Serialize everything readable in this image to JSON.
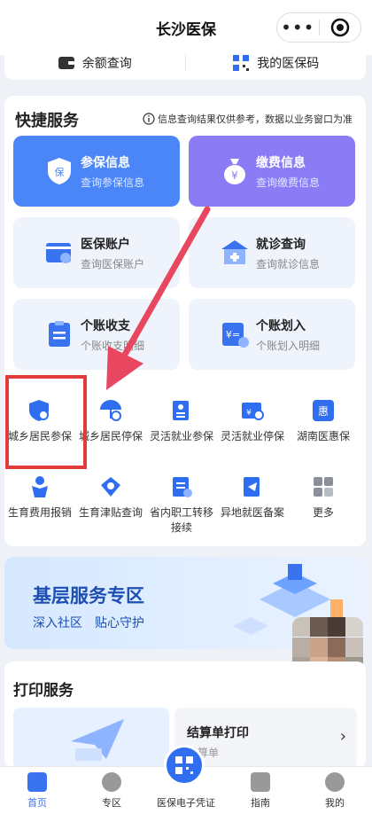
{
  "header": {
    "title": "长沙医保"
  },
  "top_links": [
    {
      "label": "余额查询",
      "icon": "wallet-icon"
    },
    {
      "label": "我的医保码",
      "icon": "qrcode-icon"
    }
  ],
  "quick": {
    "title": "快捷服务",
    "notice": "信息查询结果仅供参考，数据以业务窗口为准",
    "tiles": [
      {
        "name": "参保信息",
        "sub": "查询参保信息",
        "icon": "shield-insurance-icon"
      },
      {
        "name": "缴费信息",
        "sub": "查询缴费信息",
        "icon": "money-bag-icon"
      },
      {
        "name": "医保账户",
        "sub": "查询医保账户",
        "icon": "account-card-icon"
      },
      {
        "name": "就诊查询",
        "sub": "查询就诊信息",
        "icon": "hospital-icon"
      },
      {
        "name": "个账收支",
        "sub": "个账收支明细",
        "icon": "clipboard-icon"
      },
      {
        "name": "个账划入",
        "sub": "个账划入明细",
        "icon": "transfer-in-icon"
      }
    ],
    "grid": [
      {
        "label": "城乡居民参保",
        "icon": "shield-search-icon"
      },
      {
        "label": "城乡居民停保",
        "icon": "umbrella-stop-icon"
      },
      {
        "label": "灵活就业参保",
        "icon": "person-doc-icon"
      },
      {
        "label": "灵活就业停保",
        "icon": "card-stop-icon"
      },
      {
        "label": "湖南医惠保",
        "icon": "hui-icon"
      },
      {
        "label": "生育费用报销",
        "icon": "baby-icon"
      },
      {
        "label": "生育津贴查询",
        "icon": "allowance-icon"
      },
      {
        "label": "省内职工转移接续",
        "icon": "transfer-doc-icon"
      },
      {
        "label": "异地就医备案",
        "icon": "plane-doc-icon"
      },
      {
        "label": "更多",
        "icon": "more-grid-icon"
      }
    ]
  },
  "banner": {
    "title": "基层服务专区",
    "subtitle": "深入社区　贴心守护"
  },
  "print": {
    "title": "打印服务",
    "item_name": "结算单打印",
    "item_sub": "结算单"
  },
  "tabbar": [
    {
      "label": "首页",
      "icon": "home-icon"
    },
    {
      "label": "专区",
      "icon": "location-icon"
    },
    {
      "label": "医保电子凭证",
      "icon": "qrcode-icon"
    },
    {
      "label": "指南",
      "icon": "guide-icon"
    },
    {
      "label": "我的",
      "icon": "user-icon"
    }
  ],
  "colors": {
    "accent": "#3a73f0",
    "blue_tile": "#4a86f7",
    "purple_tile": "#8b7cf6",
    "highlight": "#e23b3b"
  }
}
